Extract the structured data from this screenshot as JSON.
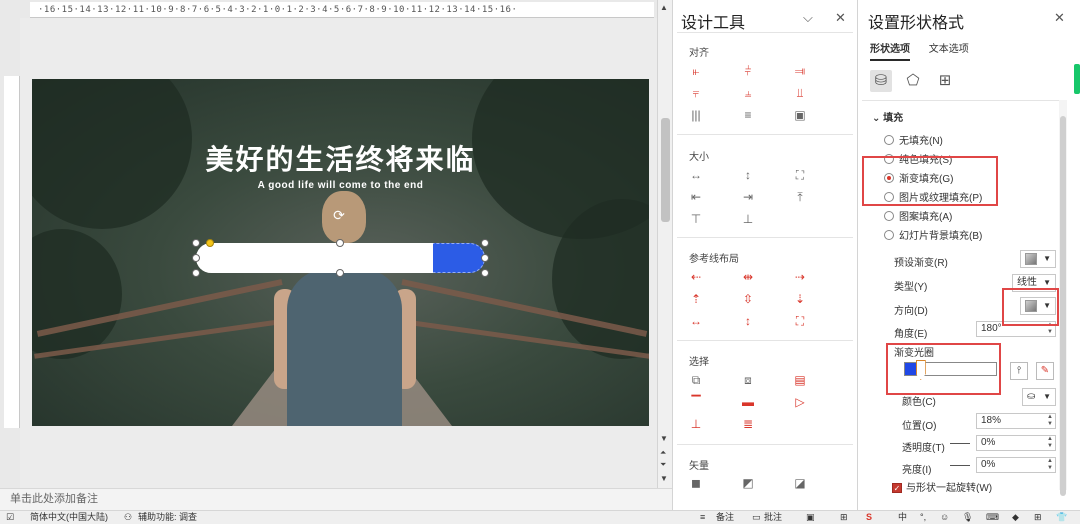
{
  "colors": {
    "accent_red": "#d9362b",
    "progress_blue": "#2c5ce6",
    "highlight_box": "#e04646"
  },
  "ruler": {
    "h_ticks": "·16·15·14·13·12·11·10·9·8·7·6·5·4·3·2·1·0·1·2·3·4·5·6·7·8·9·10·11·12·13·14·15·16·"
  },
  "slide": {
    "title": "美好的生活终将来临",
    "subtitle": "A good life will come to the end"
  },
  "notes": {
    "placeholder": "单击此处添加备注"
  },
  "status": {
    "language": "简体中文(中国大陆)",
    "accessibility": "辅助功能: 调查",
    "notes_btn": "备注",
    "comments_btn": "批注"
  },
  "design_panel": {
    "title": "设计工具",
    "sections": {
      "align": "对齐",
      "size": "大小",
      "guides": "参考线布局",
      "select": "选择",
      "vector": "矢量"
    }
  },
  "format_panel": {
    "title": "设置形状格式",
    "tabs": [
      "形状选项",
      "文本选项"
    ],
    "fill_section": "填充",
    "fill_options": [
      "无填充(N)",
      "纯色填充(S)",
      "渐变填充(G)",
      "图片或纹理填充(P)",
      "图案填充(A)",
      "幻灯片背景填充(B)"
    ],
    "selected_fill": "渐变填充(G)",
    "preset_label": "预设渐变(R)",
    "type_label": "类型(Y)",
    "type_value": "线性",
    "direction_label": "方向(D)",
    "angle_label": "角度(E)",
    "angle_value": "180°",
    "stops_label": "渐变光圈",
    "color_label": "颜色(C)",
    "position_label": "位置(O)",
    "position_value": "18%",
    "transparency_label": "透明度(T)",
    "transparency_value": "0%",
    "brightness_label": "亮度(I)",
    "brightness_value": "0%",
    "rotate_label": "与形状一起旋转(W)",
    "gradient_stop_position": 0.18
  },
  "progress_fill_fraction": 0.82,
  "icons": [
    "undo-icon",
    "redo-icon",
    "rotate-icon",
    "fill-bucket-icon",
    "pentagon-icon",
    "size-icon",
    "close-icon",
    "chevron-down-icon"
  ]
}
